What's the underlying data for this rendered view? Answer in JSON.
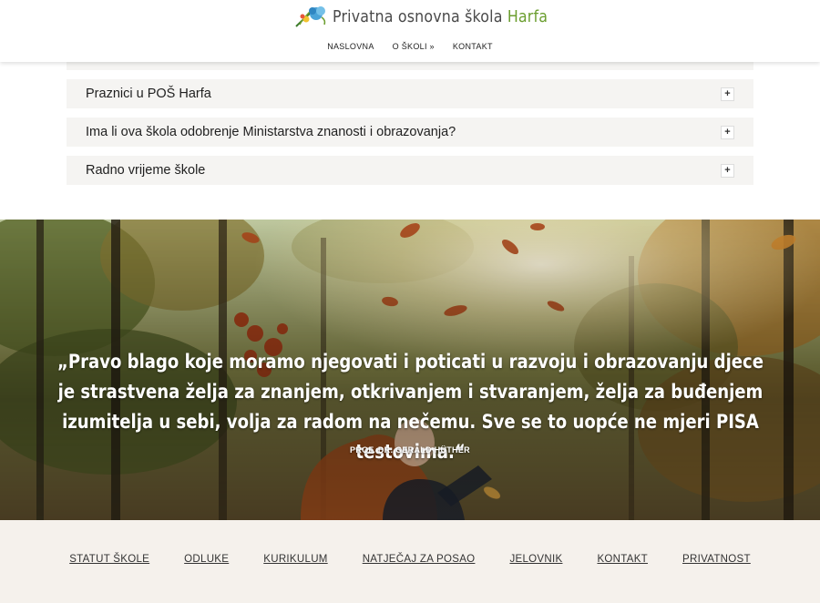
{
  "header": {
    "brand_prefix": "Privatna osnovna škola ",
    "brand_accent": "Harfa",
    "logo_icon": "harp-flower-logo-icon",
    "nav": [
      {
        "label": "NASLOVNA"
      },
      {
        "label": "O ŠKOLI »"
      },
      {
        "label": "KONTAKT"
      }
    ]
  },
  "faq": {
    "items": [
      {
        "title": "Praznici u POŠ Harfa",
        "toggle": "+"
      },
      {
        "title": "Ima li ova škola odobrenje Ministarstva znanosti i obrazovanja?",
        "toggle": "+"
      },
      {
        "title": "Radno vrijeme škole",
        "toggle": "+"
      }
    ]
  },
  "hero": {
    "quote": "„Pravo blago koje moramo njegovati i poticati u razvoju i obrazovanju djece je strastvena želja za znanjem, otkrivanjem i stvaranjem, želja za buđenjem izumitelja u sebi, volja za radom na nečemu. Sve se to uopće ne mjeri PISA testovima.“",
    "author": "PROF. DR. GERALD HÜTHER"
  },
  "footer": {
    "links": [
      {
        "label": "STATUT ŠKOLE"
      },
      {
        "label": "ODLUKE"
      },
      {
        "label": "KURIKULUM"
      },
      {
        "label": "NATJEČAJ ZA POSAO"
      },
      {
        "label": "JELOVNIK"
      },
      {
        "label": "KONTAKT"
      },
      {
        "label": "PRIVATNOST"
      }
    ]
  },
  "colors": {
    "brand_accent": "#6b9e2f",
    "accordion_bg": "#f5f4f2",
    "footer_bg": "#f5f1ec"
  }
}
